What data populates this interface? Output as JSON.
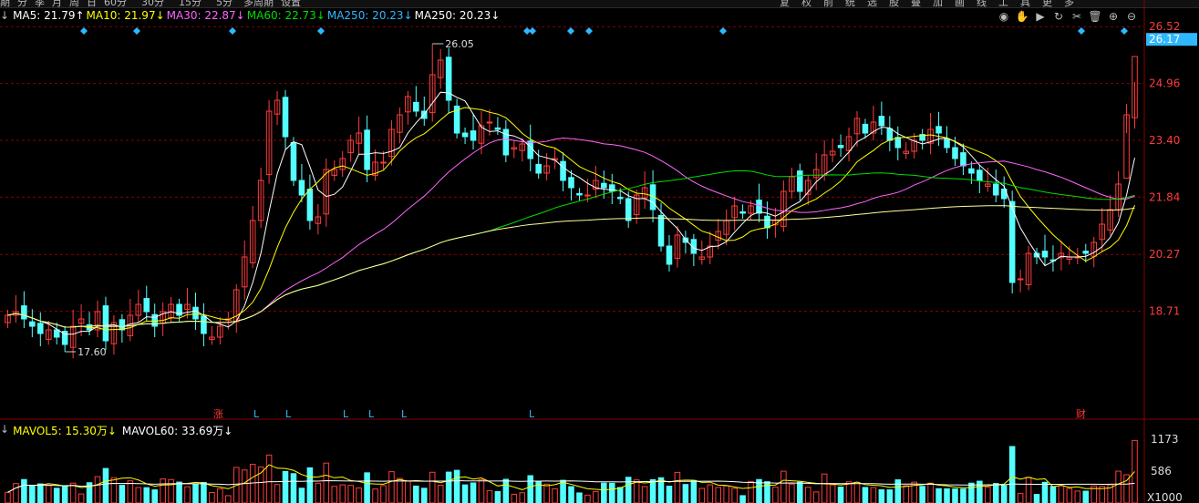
{
  "topbar": {
    "left_items": [
      "期",
      "分",
      "季",
      "月",
      "周",
      "日",
      "60分",
      "30分",
      "15分",
      "5分",
      "多周期",
      "设置"
    ],
    "right_items": [
      "复",
      "权",
      "前",
      "统",
      "选",
      "股",
      "叠",
      "加",
      "画",
      "线",
      "工",
      "具",
      "更",
      "多"
    ]
  },
  "ma_legend": [
    {
      "label": "MA5: 21.79↑",
      "color": "#ffffff"
    },
    {
      "label": "MA10: 21.97↓",
      "color": "#ffff00"
    },
    {
      "label": "MA30: 22.87↓",
      "color": "#ff66ff"
    },
    {
      "label": "MA60: 22.73↓",
      "color": "#00dd00"
    },
    {
      "label": "MA250: 20.23↓",
      "color": "#2fb8ff"
    },
    {
      "label": "MA250: 20.23↓",
      "color": "#ffffff"
    }
  ],
  "volume_legend": [
    {
      "label": "MAVOL5: 15.30万↓",
      "color": "#ffff00"
    },
    {
      "label": "MAVOL60: 33.69万↓",
      "color": "#ffffff"
    }
  ],
  "toolbar_icons": [
    "eye-icon",
    "hand-icon",
    "play-icon",
    "refresh-icon",
    "scissors-icon",
    "trash-icon",
    "zoom-in-icon",
    "zoom-out-icon"
  ],
  "price_axis": {
    "ticks": [
      "26.52",
      "24.96",
      "23.40",
      "21.84",
      "20.27",
      "18.71"
    ],
    "current_price": "26.17",
    "current_color": "#2fb8ff"
  },
  "volume_axis": {
    "ticks": [
      "1173",
      "586"
    ],
    "unit": "X1000"
  },
  "annotations": {
    "high": "26.05",
    "low": "17.60"
  },
  "markers": [
    {
      "text": "涨",
      "color": "#ff3b3b"
    },
    {
      "text": "L",
      "color": "#2fb8ff"
    },
    {
      "text": "财",
      "color": "#ff3b3b"
    }
  ],
  "colors": {
    "up": "#ff3b3b",
    "down": "#54ffff",
    "grid": "#8a0000",
    "ma5": "#ffffff",
    "ma10": "#ffff00",
    "ma30": "#ff66ff",
    "ma60": "#00dd00",
    "ma250": "#ffff99"
  },
  "chart_data": {
    "type": "candlestick",
    "price_range": [
      15.8,
      26.8
    ],
    "y_ticks": [
      26.52,
      24.96,
      23.4,
      21.84,
      20.27,
      18.71
    ],
    "high_point": 26.05,
    "low_point": 17.6,
    "close_series": [
      18.6,
      18.7,
      18.5,
      18.3,
      18.1,
      18.2,
      18.0,
      17.8,
      18.3,
      18.5,
      18.2,
      18.7,
      17.9,
      18.4,
      18.2,
      18.6,
      18.9,
      18.7,
      18.3,
      18.7,
      18.9,
      18.6,
      18.9,
      18.5,
      18.1,
      18.0,
      18.3,
      18.5,
      19.3,
      20.2,
      21.2,
      22.3,
      24.2,
      24.5,
      23.5,
      22.3,
      21.9,
      21.2,
      21.3,
      22.6,
      22.6,
      22.9,
      23.4,
      23.6,
      22.6,
      22.8,
      22.8,
      23.7,
      24.1,
      24.6,
      24.2,
      24.0,
      25.2,
      25.6,
      24.5,
      23.6,
      23.5,
      23.4,
      23.8,
      23.9,
      23.7,
      23.0,
      23.2,
      23.3,
      22.9,
      22.5,
      22.7,
      22.9,
      22.3,
      22.1,
      21.9,
      21.9,
      22.3,
      22.1,
      22.0,
      21.8,
      21.2,
      21.9,
      22.1,
      21.5,
      20.5,
      20.0,
      20.8,
      20.6,
      20.3,
      20.2,
      20.5,
      20.9,
      21.2,
      21.6,
      21.4,
      21.6,
      21.4,
      21.0,
      21.2,
      22.0,
      22.4,
      22.0,
      22.3,
      22.6,
      23.0,
      23.1,
      23.2,
      23.5,
      24.0,
      23.6,
      23.9,
      23.8,
      23.4,
      23.2,
      23.1,
      23.4,
      23.4,
      23.7,
      23.6,
      23.2,
      22.9,
      22.7,
      22.5,
      22.3,
      22.2,
      21.9,
      21.8,
      19.5,
      19.6,
      20.3,
      20.2,
      20.2,
      20.1,
      20.3,
      20.2,
      20.2,
      20.3,
      20.6,
      21.1,
      21.5,
      22.2,
      24.1,
      25.7
    ],
    "volume_max": 1173,
    "volume_ticks": [
      1173,
      586
    ]
  }
}
